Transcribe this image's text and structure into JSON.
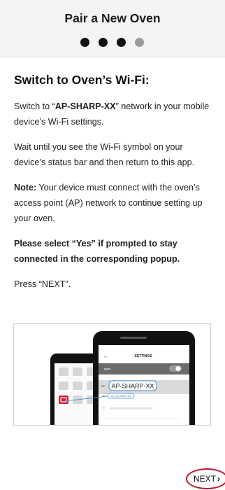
{
  "header": {
    "title": "Pair a New Oven",
    "steps": [
      {
        "state": "active"
      },
      {
        "state": "active"
      },
      {
        "state": "active"
      },
      {
        "state": "inactive"
      }
    ]
  },
  "content": {
    "title": "Switch to Oven’s Wi-Fi:",
    "p1_a": "Switch to “",
    "p1_network": "AP-SHARP-XX",
    "p1_b": "” network in your mobile device’s Wi-Fi settings.",
    "p2": "Wait until you see the Wi-Fi symbol on your device’s status bar and then return to this app.",
    "p3_note": "Note:",
    "p3_text": " Your device must connect with the oven’s access point (AP) network to continue setting up your oven.",
    "p4": "Please select “Yes” if prompted to stay connected in the corresponding popup.",
    "p5": "Press “NEXT”."
  },
  "illustration": {
    "settings_title": "SETTINGS",
    "wifi_label": "WIFI",
    "network_prefix": "AP",
    "network_callout": "AP-SHARP-XX",
    "network_small": "AP-SHARP-XX",
    "accent_color": "#d81e3a"
  },
  "footer": {
    "next_label": "NEXT",
    "next_chevron": "›",
    "highlight_color": "#c0162b"
  }
}
